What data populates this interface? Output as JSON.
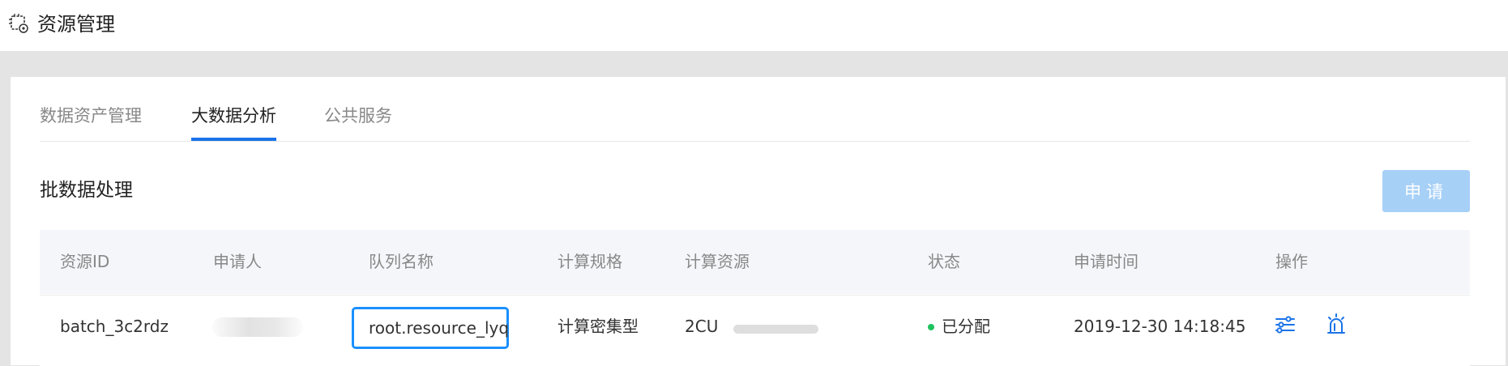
{
  "header": {
    "title": "资源管理",
    "icon": "chip-gear-icon"
  },
  "tabs": [
    {
      "label": "数据资产管理",
      "active": false
    },
    {
      "label": "大数据分析",
      "active": true
    },
    {
      "label": "公共服务",
      "active": false
    }
  ],
  "section": {
    "title": "批数据处理",
    "apply_label": "申请"
  },
  "table": {
    "columns": [
      "资源ID",
      "申请人",
      "队列名称",
      "计算规格",
      "计算资源",
      "状态",
      "申请时间",
      "操作"
    ],
    "rows": [
      {
        "resource_id": "batch_3c2rdz",
        "queue_name": "root.resource_lyq",
        "spec": "计算密集型",
        "resource": "2CU",
        "status": "已分配",
        "status_color": "#1fc35e",
        "apply_time": "2019-12-30 14:18:45",
        "actions": [
          "settings-sliders-icon",
          "alarm-light-icon"
        ]
      }
    ]
  },
  "colors": {
    "accent": "#1a73e8",
    "button_disabled": "#a7d0f7",
    "focus_border": "#1a90ff"
  }
}
